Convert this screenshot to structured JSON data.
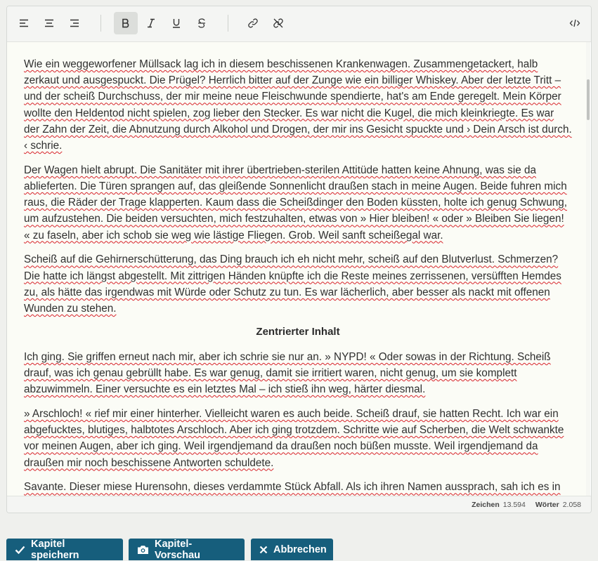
{
  "toolbar": {
    "buttons": [
      {
        "icon": "align-left-icon"
      },
      {
        "icon": "align-center-icon"
      },
      {
        "icon": "align-right-icon"
      },
      {
        "icon": "bold-icon",
        "active": true
      },
      {
        "icon": "italic-icon"
      },
      {
        "icon": "underline-icon"
      },
      {
        "icon": "strikethrough-icon"
      },
      {
        "icon": "link-icon"
      },
      {
        "icon": "unlink-icon"
      },
      {
        "icon": "code-view-icon"
      }
    ]
  },
  "content": {
    "paragraphs": [
      "Wie ein weggeworfener Müllsack lag ich in diesem beschissenen Krankenwagen. Zusammengetackert, halb zerkaut und ausgespuckt. Die Prügel? Herrlich bitter auf der Zunge wie ein billiger Whiskey. Aber der letzte Tritt – und der scheiß Durchschuss, der mir meine neue Fleischwunde spendierte, hat's am Ende geregelt. Mein Körper wollte den Heldentod nicht spielen, zog lieber den Stecker. Es war nicht die Kugel, die mich kleinkriegte. Es war der Zahn der Zeit, die Abnutzung durch Alkohol und Drogen, der mir ins Gesicht spuckte und › Dein Arsch ist durch. ‹ schrie.",
      "Der Wagen hielt abrupt. Die Sanitäter mit ihrer übertrieben-sterilen Attitüde hatten keine Ahnung, was sie da ablieferten. Die Türen sprangen auf, das gleißende Sonnenlicht draußen stach in meine Augen. Beide fuhren mich raus, die Räder der Trage klapperten. Kaum dass die Scheißdinger den Boden küssten, holte ich genug Schwung, um aufzustehen. Die beiden versuchten, mich festzuhalten, etwas von » Hier bleiben! « oder » Bleiben Sie liegen! « zu faseln, aber ich schob sie weg wie lästige Fliegen. Grob. Weil sanft scheißegal war.",
      "Scheiß auf die Gehirnerschütterung, das Ding brauch ich eh nicht mehr, scheiß auf den Blutverlust. Schmerzen? Die hatte ich längst abgestellt. Mit zittrigen Händen knüpfte ich die Reste meines zerrissenen, versüfften Hemdes zu, als hätte das irgendwas mit Würde oder Schutz zu tun. Es war lächerlich, aber besser als nackt mit offenen Wunden zu stehen."
    ],
    "heading": "Zentrierter Inhalt",
    "paragraphs2": [
      "Ich ging. Sie griffen erneut nach mir, aber ich schrie sie nur an. » NYPD! « Oder sowas in der Richtung. Scheiß drauf, was ich genau gebrüllt habe. Es war genug, damit sie irritiert waren, nicht genug, um sie komplett abzuwimmeln. Einer versuchte es ein letztes Mal – ich stieß ihn weg, härter diesmal.",
      "» Arschloch! « rief mir einer hinterher. Vielleicht waren es auch beide. Scheiß drauf, sie hatten Recht. Ich war ein abgefucktes, blutiges, halbtotes Arschloch. Aber ich ging trotzdem. Schritte wie auf Scherben, die Welt schwankte vor meinen Augen, aber ich ging. Weil irgendjemand da draußen noch büßen musste. Weil irgendjemand da draußen mir noch beschissene Antworten schuldete.",
      "Savante. Dieser miese Hurensohn, dieses verdammte Stück Abfall. Als ich ihren Namen aussprach, sah ich es in seinen Augen. Ein Zucken, ein Funke, der verriet: Er wusste mehr, als er zugab. Ein Dreckssack in einem makellosen Anzug."
    ]
  },
  "status": {
    "chars_label": "Zeichen",
    "chars_value": "13.594",
    "words_label": "Wörter",
    "words_value": "2.058"
  },
  "actions": {
    "save_label": "Kapitel speichern",
    "preview_label": "Kapitel-Vorschau",
    "cancel_label": "Abbrechen"
  },
  "colors": {
    "accent": "#165e7c",
    "spellcheck": "#d8232a",
    "editor_bg": "#fbfcf6"
  }
}
